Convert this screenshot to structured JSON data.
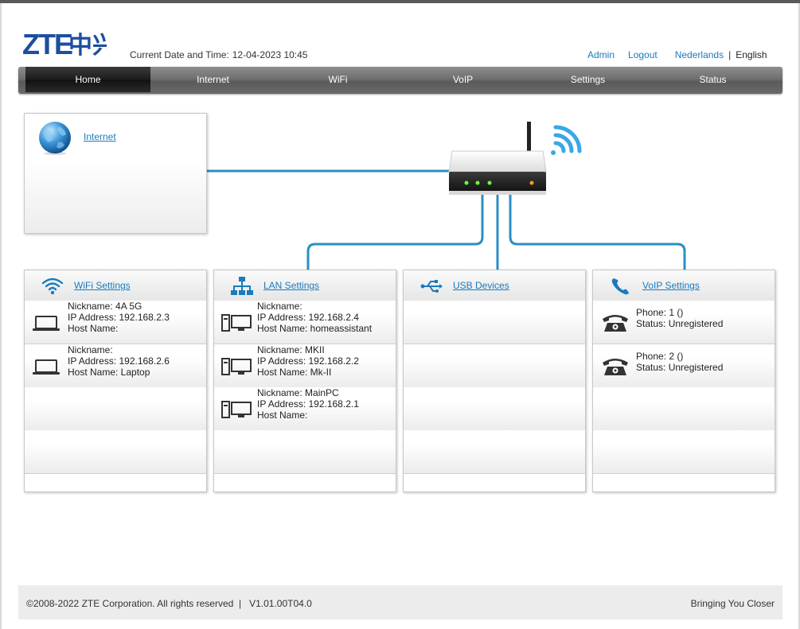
{
  "header": {
    "logo_text": "ZTE中兴",
    "datetime_label": "Current Date and Time:",
    "datetime_value": "12-04-2023 10:45",
    "admin_label": "Admin",
    "logout_label": "Logout",
    "lang_nl": "Nederlands",
    "lang_sep": "|",
    "lang_en": "English"
  },
  "nav": {
    "items": [
      "Home",
      "Internet",
      "WiFi",
      "VoIP",
      "Settings",
      "Status"
    ],
    "active": "Home"
  },
  "internet": {
    "label": "Internet"
  },
  "wifi": {
    "title": "WiFi Settings",
    "devices": [
      {
        "nickname": "Nickname: 4A 5G",
        "ip": "IP Address: 192.168.2.3",
        "host": "Host Name:"
      },
      {
        "nickname": "Nickname:",
        "ip": "IP Address: 192.168.2.6",
        "host": "Host Name: Laptop"
      }
    ]
  },
  "lan": {
    "title": "LAN Settings",
    "devices": [
      {
        "nickname": "Nickname:",
        "ip": "IP Address: 192.168.2.4",
        "host": "Host Name: homeassistant"
      },
      {
        "nickname": "Nickname: MKII",
        "ip": "IP Address: 192.168.2.2",
        "host": "Host Name: Mk-II"
      },
      {
        "nickname": "Nickname: MainPC",
        "ip": "IP Address: 192.168.2.1",
        "host": "Host Name:"
      }
    ]
  },
  "usb": {
    "title": "USB Devices"
  },
  "voip": {
    "title": "VoIP Settings",
    "phones": [
      {
        "phone": "Phone: 1 ()",
        "status": "Status: Unregistered"
      },
      {
        "phone": "Phone: 2 ()",
        "status": "Status: Unregistered"
      }
    ]
  },
  "footer": {
    "copyright": "©2008-2022 ZTE Corporation. All rights reserved  |   V1.01.00T04.0",
    "slogan": "Bringing You Closer"
  },
  "colors": {
    "link": "#1a7bbd",
    "line": "#2a8fc4",
    "nav_bg": "#6e6e6e",
    "nav_active": "#1c1c1c"
  }
}
